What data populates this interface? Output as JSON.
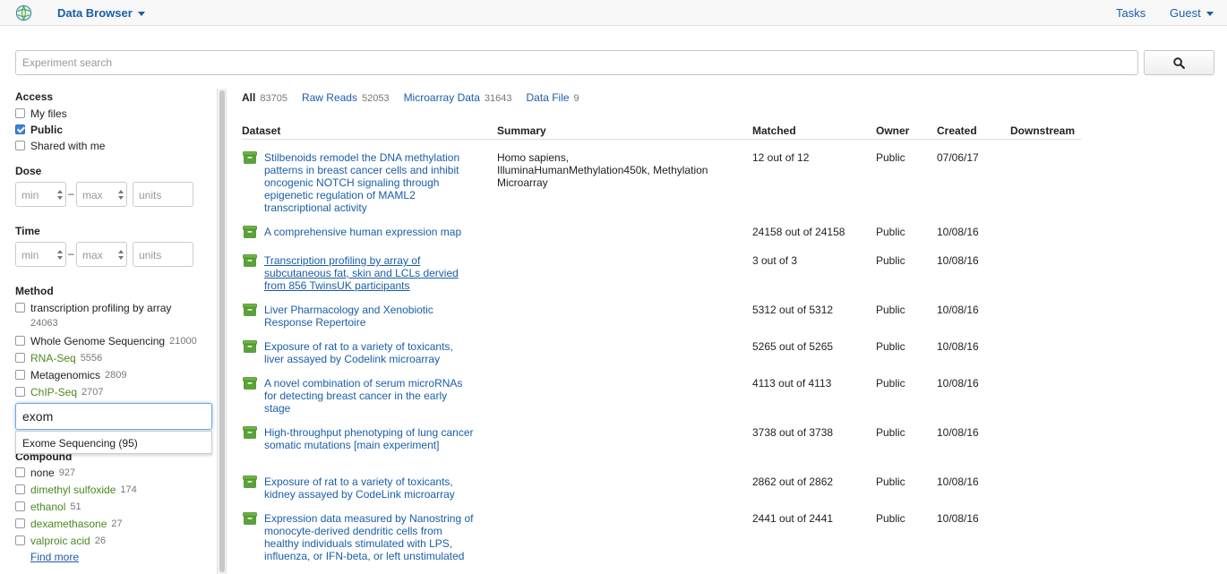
{
  "nav": {
    "brand": "Data Browser",
    "tasks": "Tasks",
    "guest": "Guest"
  },
  "search": {
    "placeholder": "Experiment search",
    "value": ""
  },
  "sidebar": {
    "access": {
      "title": "Access",
      "items": [
        {
          "label": "My files",
          "checked": false
        },
        {
          "label": "Public",
          "checked": true
        },
        {
          "label": "Shared with me",
          "checked": false
        }
      ]
    },
    "dose": {
      "title": "Dose",
      "min": "min",
      "max": "max",
      "units": "units",
      "dash": "–"
    },
    "time": {
      "title": "Time",
      "min": "min",
      "max": "max",
      "units": "units",
      "dash": "–"
    },
    "method": {
      "title": "Method",
      "items": [
        {
          "label": "transcription profiling by array",
          "count": "24063"
        },
        {
          "label": "Whole Genome Sequencing",
          "count": "21000"
        },
        {
          "label": "RNA-Seq",
          "count": "5556"
        },
        {
          "label": "Metagenomics",
          "count": "2809"
        },
        {
          "label": "ChIP-Seq",
          "count": "2707"
        }
      ],
      "filter_value": "exom",
      "suggestion": "Exome Sequencing (95)"
    },
    "compound": {
      "title": "Compound",
      "items": [
        {
          "label": "none",
          "count": "927"
        },
        {
          "label": "dimethyl sulfoxide",
          "count": "174"
        },
        {
          "label": "ethanol",
          "count": "51"
        },
        {
          "label": "dexamethasone",
          "count": "27"
        },
        {
          "label": "valproic acid",
          "count": "26"
        }
      ],
      "find_more": "Find more"
    }
  },
  "tabs": [
    {
      "label": "All",
      "count": "83705",
      "active": true
    },
    {
      "label": "Raw Reads",
      "count": "52053",
      "active": false
    },
    {
      "label": "Microarray Data",
      "count": "31643",
      "active": false
    },
    {
      "label": "Data File",
      "count": "9",
      "active": false
    }
  ],
  "table": {
    "columns": [
      "Dataset",
      "Summary",
      "Matched",
      "Owner",
      "Created",
      "Downstream"
    ],
    "rows": [
      {
        "title": "Stilbenoids remodel the DNA methylation patterns in breast cancer cells and inhibit oncogenic NOTCH signaling through epigenetic regulation of MAML2 transcriptional activity",
        "summary": "Homo sapiens, IlluminaHumanMethylation450k, Methylation Microarray",
        "matched": "12 out of 12",
        "owner": "Public",
        "created": "07/06/17",
        "downstream": ""
      },
      {
        "title": "A comprehensive human expression map",
        "summary": "",
        "matched": "24158 out of 24158",
        "owner": "Public",
        "created": "10/08/16",
        "downstream": ""
      },
      {
        "title": "Transcription profiling by array of subcutaneous fat, skin and LCLs dervied from 856 TwinsUK participants",
        "summary": "",
        "matched": "3 out of 3",
        "owner": "Public",
        "created": "10/08/16",
        "downstream": ""
      },
      {
        "title": "Liver Pharmacology and Xenobiotic Response Repertoire",
        "summary": "",
        "matched": "5312 out of 5312",
        "owner": "Public",
        "created": "10/08/16",
        "downstream": ""
      },
      {
        "title": "Exposure of rat to a variety of toxicants, liver assayed by Codelink microarray",
        "summary": "",
        "matched": "5265 out of 5265",
        "owner": "Public",
        "created": "10/08/16",
        "downstream": ""
      },
      {
        "title": "A novel combination of serum microRNAs for detecting breast cancer in the early stage",
        "summary": "",
        "matched": "4113 out of 4113",
        "owner": "Public",
        "created": "10/08/16",
        "downstream": ""
      },
      {
        "title": "High-throughput phenotyping of lung cancer somatic mutations [main experiment]",
        "summary": "",
        "matched": "3738 out of 3738",
        "owner": "Public",
        "created": "10/08/16",
        "downstream": ""
      },
      {
        "title": "Exposure of rat to a variety of toxicants, kidney assayed by CodeLink microarray",
        "summary": "",
        "matched": "2862 out of 2862",
        "owner": "Public",
        "created": "10/08/16",
        "downstream": ""
      },
      {
        "title": "Expression data measured by Nanostring of monocyte-derived dendritic cells from healthy individuals stimulated with LPS, influenza, or IFN-beta, or left unstimulated",
        "summary": "",
        "matched": "2441 out of 2441",
        "owner": "Public",
        "created": "10/08/16",
        "downstream": ""
      }
    ]
  },
  "icons": {
    "logo": "globe-logo-icon",
    "search": "search-icon",
    "dataset": "dataset-box-icon",
    "dataset_color": "#5aa33a",
    "link_color": "#1a5ea8",
    "facet_link_color": "#4a8a1f"
  }
}
